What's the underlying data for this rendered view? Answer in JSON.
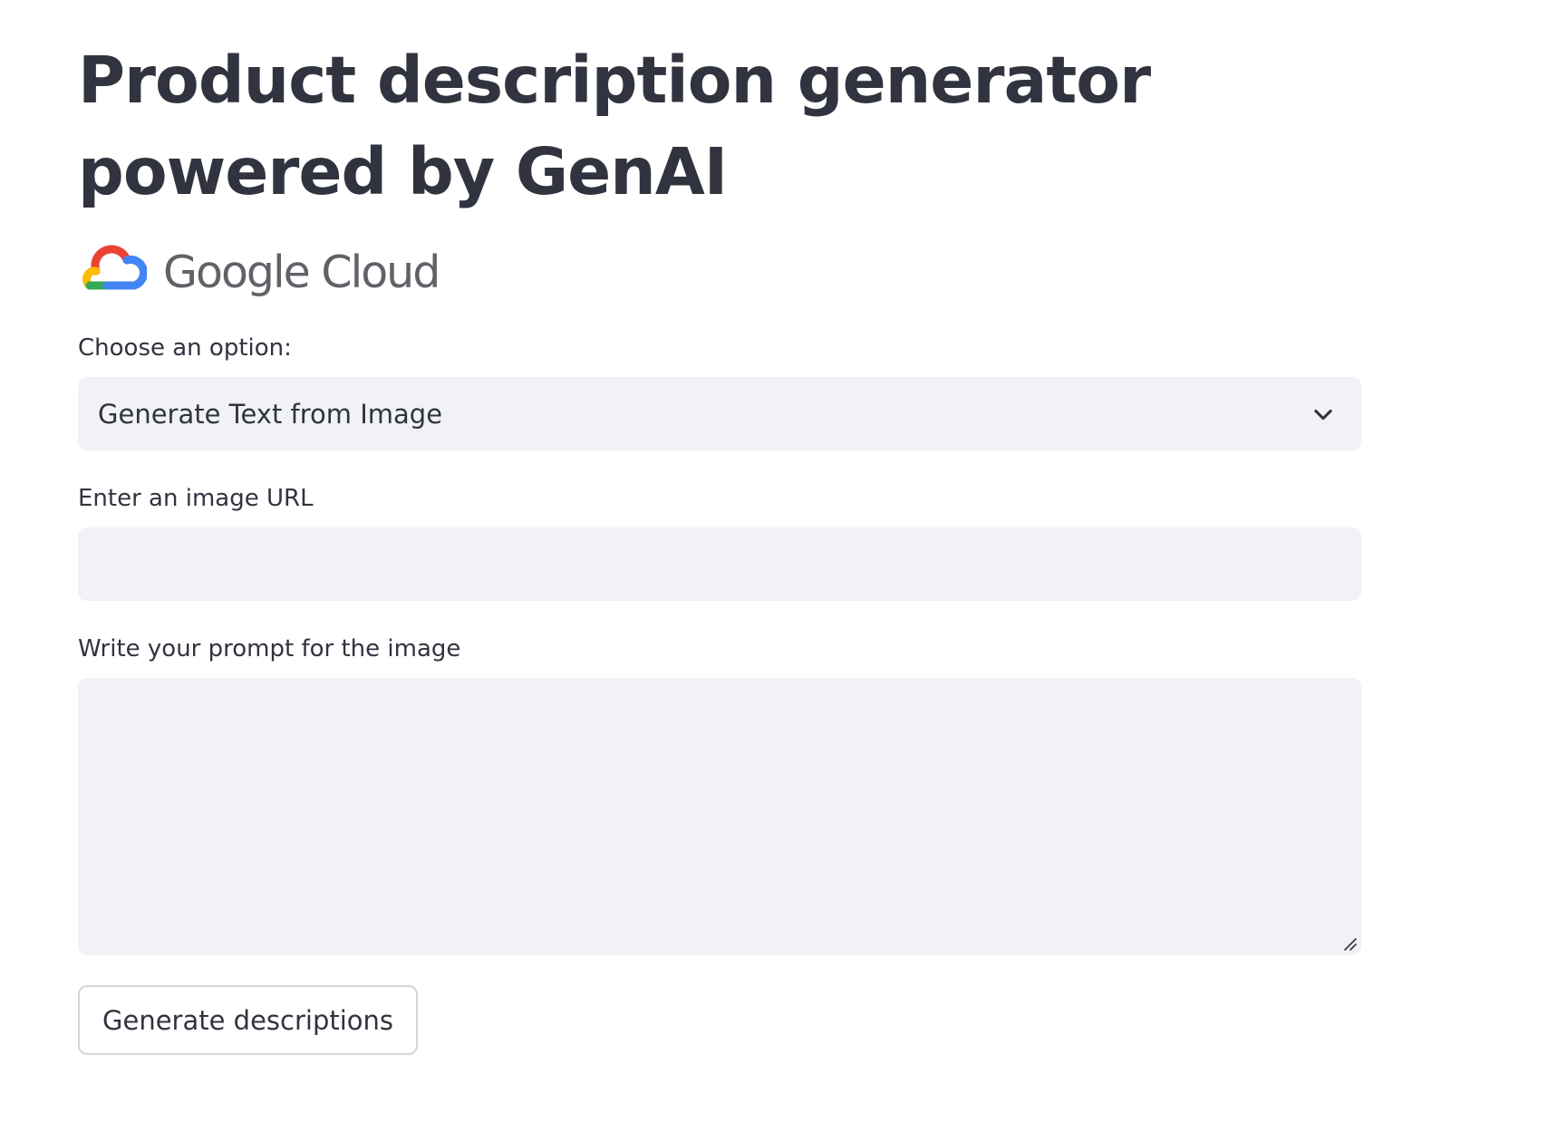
{
  "page": {
    "title": "Product description generator powered by GenAI"
  },
  "logo": {
    "icon": "google-cloud-icon",
    "text": "Google Cloud",
    "colors": {
      "red": "#ea4335",
      "blue": "#4285f4",
      "yellow": "#fbbc04",
      "green": "#34a853",
      "text": "#5f6368"
    }
  },
  "option_select": {
    "label": "Choose an option:",
    "selected": "Generate Text from Image",
    "icon": "chevron-down-icon"
  },
  "url_input": {
    "label": "Enter an image URL",
    "value": "",
    "placeholder": ""
  },
  "prompt_input": {
    "label": "Write your prompt for the image",
    "value": "",
    "placeholder": "",
    "icon": "resize-handle-icon"
  },
  "actions": {
    "generate_label": "Generate descriptions"
  },
  "theme": {
    "text": "#31333f",
    "input_background": "#f0f2f6",
    "button_border": "#d6d6d9",
    "background": "#ffffff"
  }
}
